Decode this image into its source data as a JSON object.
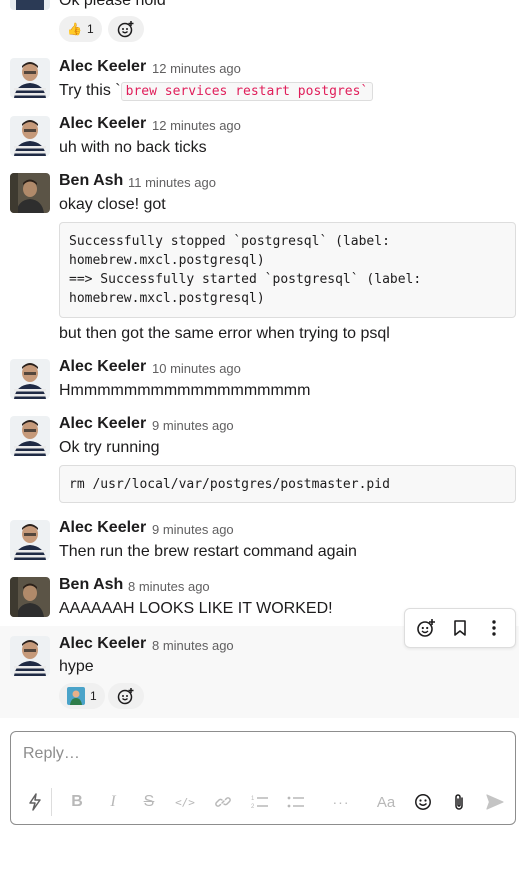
{
  "colors": {
    "text": "#1d1c1d",
    "muted": "#616061",
    "code_red": "#e01e5a",
    "hover_bg": "#f8f8f8"
  },
  "top_partial": {
    "text": "Ok please hold",
    "reaction": {
      "emoji": "👍",
      "count": "1"
    }
  },
  "messages": [
    {
      "author": "Alec Keeler",
      "time": "12 minutes ago",
      "text_prefix": "Try this `",
      "code": "brew services restart postgres`"
    },
    {
      "author": "Alec Keeler",
      "time": "12 minutes ago",
      "text": "uh with no back ticks"
    },
    {
      "author": "Ben Ash",
      "time": "11 minutes ago",
      "text": "okay close! got",
      "code_block": "Successfully stopped `postgresql` (label:\nhomebrew.mxcl.postgresql)\n==> Successfully started `postgresql` (label:\nhomebrew.mxcl.postgresql)",
      "text_after": "but then got the same error when trying to psql"
    },
    {
      "author": "Alec Keeler",
      "time": "10 minutes ago",
      "text": "Hmmmmmmmmmmmmmmmmmm"
    },
    {
      "author": "Alec Keeler",
      "time": "9 minutes ago",
      "text": "Ok try running",
      "code_block": "rm /usr/local/var/postgres/postmaster.pid"
    },
    {
      "author": "Alec Keeler",
      "time": "9 minutes ago",
      "text": "Then run the brew restart command again"
    },
    {
      "author": "Ben Ash",
      "time": "8 minutes ago",
      "text": "AAAAAAH LOOKS LIKE IT WORKED!"
    },
    {
      "author": "Alec Keeler",
      "time": "8 minutes ago",
      "text": "hype",
      "reaction": {
        "emoji_icon": "custom-emoji-icon",
        "count": "1"
      }
    }
  ],
  "hover_toolbar": [
    "add-reaction-icon",
    "bookmark-icon",
    "more-actions-icon"
  ],
  "composer": {
    "placeholder": "Reply…",
    "format_icons": [
      "shortcuts-icon",
      "bold-icon",
      "italic-icon",
      "strikethrough-icon",
      "code-icon",
      "link-icon",
      "ordered-list-icon",
      "bulleted-list-icon",
      "more-formatting-icon",
      "text-format-icon",
      "emoji-icon",
      "attach-icon",
      "send-icon"
    ],
    "bold": "B",
    "italic": "I",
    "strike": "S",
    "code": "</>",
    "more": "···",
    "text_format": "Aa"
  }
}
